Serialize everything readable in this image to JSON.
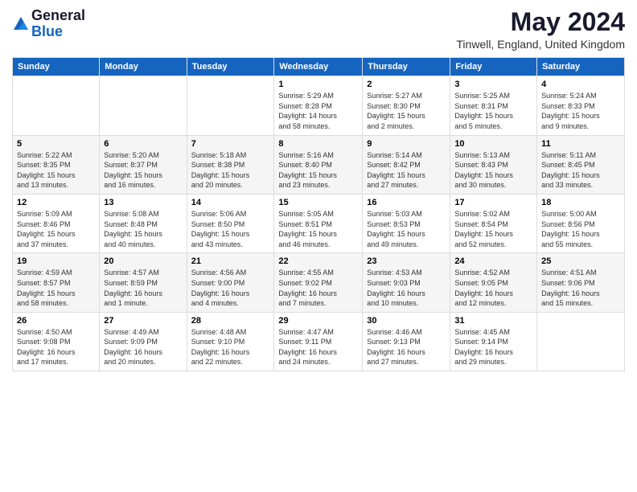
{
  "header": {
    "logo_general": "General",
    "logo_blue": "Blue",
    "month_title": "May 2024",
    "location": "Tinwell, England, United Kingdom"
  },
  "days_of_week": [
    "Sunday",
    "Monday",
    "Tuesday",
    "Wednesday",
    "Thursday",
    "Friday",
    "Saturday"
  ],
  "weeks": [
    [
      {
        "day": "",
        "info": ""
      },
      {
        "day": "",
        "info": ""
      },
      {
        "day": "",
        "info": ""
      },
      {
        "day": "1",
        "info": "Sunrise: 5:29 AM\nSunset: 8:28 PM\nDaylight: 14 hours\nand 58 minutes."
      },
      {
        "day": "2",
        "info": "Sunrise: 5:27 AM\nSunset: 8:30 PM\nDaylight: 15 hours\nand 2 minutes."
      },
      {
        "day": "3",
        "info": "Sunrise: 5:25 AM\nSunset: 8:31 PM\nDaylight: 15 hours\nand 5 minutes."
      },
      {
        "day": "4",
        "info": "Sunrise: 5:24 AM\nSunset: 8:33 PM\nDaylight: 15 hours\nand 9 minutes."
      }
    ],
    [
      {
        "day": "5",
        "info": "Sunrise: 5:22 AM\nSunset: 8:35 PM\nDaylight: 15 hours\nand 13 minutes."
      },
      {
        "day": "6",
        "info": "Sunrise: 5:20 AM\nSunset: 8:37 PM\nDaylight: 15 hours\nand 16 minutes."
      },
      {
        "day": "7",
        "info": "Sunrise: 5:18 AM\nSunset: 8:38 PM\nDaylight: 15 hours\nand 20 minutes."
      },
      {
        "day": "8",
        "info": "Sunrise: 5:16 AM\nSunset: 8:40 PM\nDaylight: 15 hours\nand 23 minutes."
      },
      {
        "day": "9",
        "info": "Sunrise: 5:14 AM\nSunset: 8:42 PM\nDaylight: 15 hours\nand 27 minutes."
      },
      {
        "day": "10",
        "info": "Sunrise: 5:13 AM\nSunset: 8:43 PM\nDaylight: 15 hours\nand 30 minutes."
      },
      {
        "day": "11",
        "info": "Sunrise: 5:11 AM\nSunset: 8:45 PM\nDaylight: 15 hours\nand 33 minutes."
      }
    ],
    [
      {
        "day": "12",
        "info": "Sunrise: 5:09 AM\nSunset: 8:46 PM\nDaylight: 15 hours\nand 37 minutes."
      },
      {
        "day": "13",
        "info": "Sunrise: 5:08 AM\nSunset: 8:48 PM\nDaylight: 15 hours\nand 40 minutes."
      },
      {
        "day": "14",
        "info": "Sunrise: 5:06 AM\nSunset: 8:50 PM\nDaylight: 15 hours\nand 43 minutes."
      },
      {
        "day": "15",
        "info": "Sunrise: 5:05 AM\nSunset: 8:51 PM\nDaylight: 15 hours\nand 46 minutes."
      },
      {
        "day": "16",
        "info": "Sunrise: 5:03 AM\nSunset: 8:53 PM\nDaylight: 15 hours\nand 49 minutes."
      },
      {
        "day": "17",
        "info": "Sunrise: 5:02 AM\nSunset: 8:54 PM\nDaylight: 15 hours\nand 52 minutes."
      },
      {
        "day": "18",
        "info": "Sunrise: 5:00 AM\nSunset: 8:56 PM\nDaylight: 15 hours\nand 55 minutes."
      }
    ],
    [
      {
        "day": "19",
        "info": "Sunrise: 4:59 AM\nSunset: 8:57 PM\nDaylight: 15 hours\nand 58 minutes."
      },
      {
        "day": "20",
        "info": "Sunrise: 4:57 AM\nSunset: 8:59 PM\nDaylight: 16 hours\nand 1 minute."
      },
      {
        "day": "21",
        "info": "Sunrise: 4:56 AM\nSunset: 9:00 PM\nDaylight: 16 hours\nand 4 minutes."
      },
      {
        "day": "22",
        "info": "Sunrise: 4:55 AM\nSunset: 9:02 PM\nDaylight: 16 hours\nand 7 minutes."
      },
      {
        "day": "23",
        "info": "Sunrise: 4:53 AM\nSunset: 9:03 PM\nDaylight: 16 hours\nand 10 minutes."
      },
      {
        "day": "24",
        "info": "Sunrise: 4:52 AM\nSunset: 9:05 PM\nDaylight: 16 hours\nand 12 minutes."
      },
      {
        "day": "25",
        "info": "Sunrise: 4:51 AM\nSunset: 9:06 PM\nDaylight: 16 hours\nand 15 minutes."
      }
    ],
    [
      {
        "day": "26",
        "info": "Sunrise: 4:50 AM\nSunset: 9:08 PM\nDaylight: 16 hours\nand 17 minutes."
      },
      {
        "day": "27",
        "info": "Sunrise: 4:49 AM\nSunset: 9:09 PM\nDaylight: 16 hours\nand 20 minutes."
      },
      {
        "day": "28",
        "info": "Sunrise: 4:48 AM\nSunset: 9:10 PM\nDaylight: 16 hours\nand 22 minutes."
      },
      {
        "day": "29",
        "info": "Sunrise: 4:47 AM\nSunset: 9:11 PM\nDaylight: 16 hours\nand 24 minutes."
      },
      {
        "day": "30",
        "info": "Sunrise: 4:46 AM\nSunset: 9:13 PM\nDaylight: 16 hours\nand 27 minutes."
      },
      {
        "day": "31",
        "info": "Sunrise: 4:45 AM\nSunset: 9:14 PM\nDaylight: 16 hours\nand 29 minutes."
      },
      {
        "day": "",
        "info": ""
      }
    ]
  ]
}
